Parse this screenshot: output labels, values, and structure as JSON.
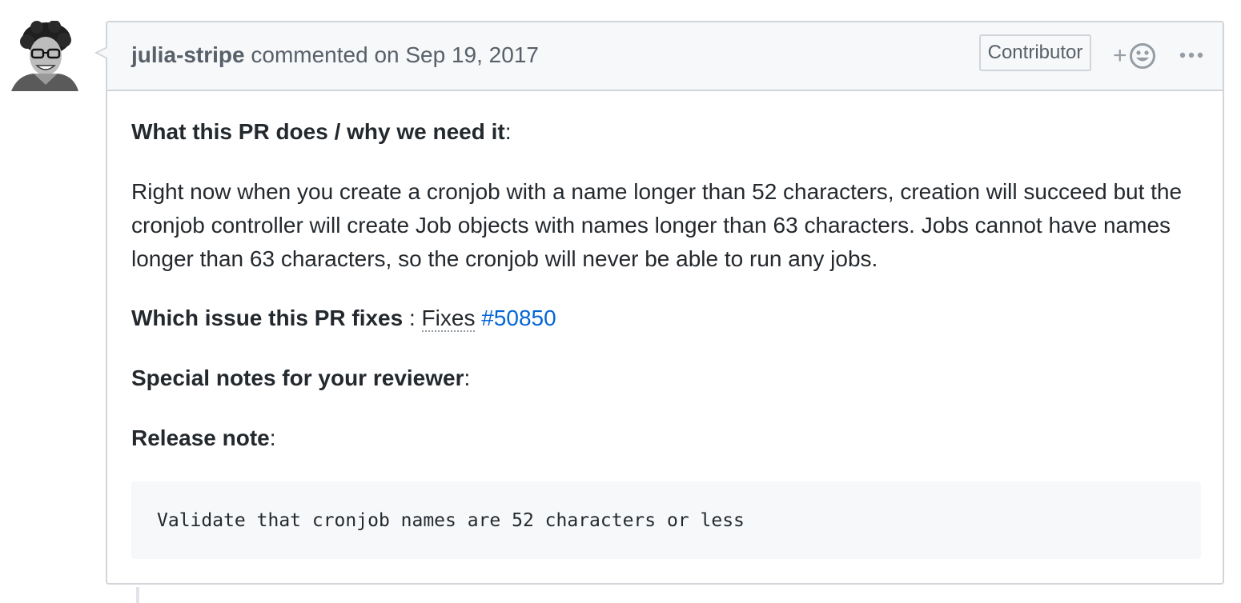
{
  "comment": {
    "author": "julia-stripe",
    "action": "commented on",
    "date": "Sep 19, 2017",
    "role_badge": "Contributor",
    "reaction_plus": "+",
    "body": {
      "section1_heading": "What this PR does / why we need it",
      "section1_colon": ":",
      "section1_text": "Right now when you create a cronjob with a name longer than 52 characters, creation will succeed but the cronjob controller will create Job objects with names longer than 63 characters. Jobs cannot have names longer than 63 characters, so the cronjob will never be able to run any jobs.",
      "section2_heading": "Which issue this PR fixes",
      "section2_sep": " : ",
      "section2_fixes": "Fixes",
      "section2_issue": "#50850",
      "section3_heading": "Special notes for your reviewer",
      "section3_colon": ":",
      "section4_heading": "Release note",
      "section4_colon": ":",
      "release_note_code": "Validate that cronjob names are 52 characters or less"
    }
  },
  "colors": {
    "link": "#0366d6",
    "border": "#d1d5da",
    "header_bg": "#f6f8fa",
    "muted_text": "#586069"
  },
  "icons": {
    "avatar": "avatar-image",
    "reaction": "smiley-icon",
    "more": "kebab-horizontal-icon"
  }
}
